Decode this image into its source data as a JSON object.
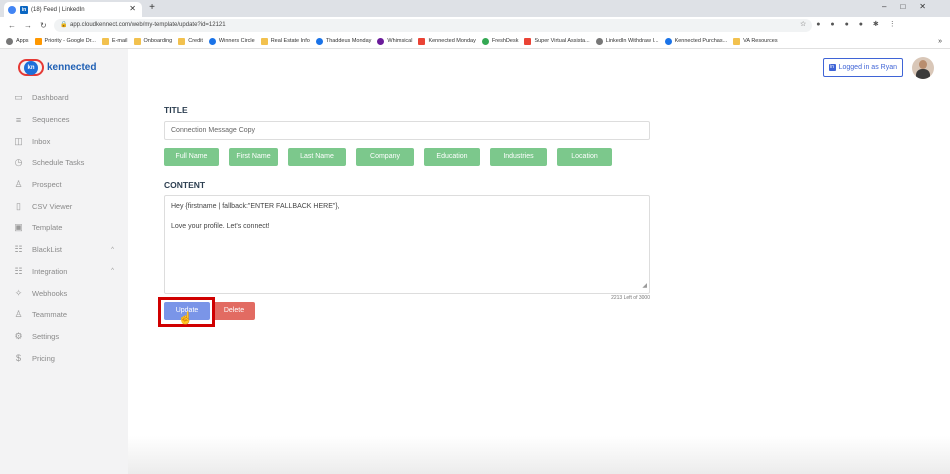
{
  "browser": {
    "tab_title": "(18) Feed | LinkedIn",
    "tab_badge": "in",
    "new_tab": "+",
    "url": "app.cloudkennect.com/web/my-template/update?id=12121",
    "bookmarks": [
      {
        "label": "Apps",
        "icon": "grey"
      },
      {
        "label": "Priority - Google Dr...",
        "icon": "orange"
      },
      {
        "label": "E-mail",
        "icon": "folder"
      },
      {
        "label": "Onboarding",
        "icon": "folder"
      },
      {
        "label": "Credit",
        "icon": "folder"
      },
      {
        "label": "Winners Circle",
        "icon": "blue"
      },
      {
        "label": "Real Estate Info",
        "icon": "folder"
      },
      {
        "label": "Thaddeus Monday",
        "icon": "blue"
      },
      {
        "label": "Whimsical",
        "icon": "purple"
      },
      {
        "label": "Kennected Monday",
        "icon": "red"
      },
      {
        "label": "FreshDesk",
        "icon": "green"
      },
      {
        "label": "Super Virtual Assista...",
        "icon": "red"
      },
      {
        "label": "LinkedIn Withdraw I...",
        "icon": "grey"
      },
      {
        "label": "Kennected Purchas...",
        "icon": "blue"
      },
      {
        "label": "VA Resources",
        "icon": "folder"
      }
    ]
  },
  "app": {
    "logo_badge": "kn",
    "logo_text": "kennected",
    "logged_in_badge": "in",
    "logged_in": "Logged in as Ryan",
    "nav": [
      {
        "label": "Dashboard",
        "icon": "monitor-icon",
        "glyph": "▭",
        "chevron": ""
      },
      {
        "label": "Sequences",
        "icon": "list-icon",
        "glyph": "≡",
        "chevron": ""
      },
      {
        "label": "Inbox",
        "icon": "chat-icon",
        "glyph": "◫",
        "chevron": ""
      },
      {
        "label": "Schedule Tasks",
        "icon": "clock-icon",
        "glyph": "◷",
        "chevron": ""
      },
      {
        "label": "Prospect",
        "icon": "user-icon",
        "glyph": "♙",
        "chevron": ""
      },
      {
        "label": "CSV Viewer",
        "icon": "file-icon",
        "glyph": "▯",
        "chevron": ""
      },
      {
        "label": "Template",
        "icon": "template-icon",
        "glyph": "▣",
        "chevron": ""
      },
      {
        "label": "BlackList",
        "icon": "blacklist-icon",
        "glyph": "☷",
        "chevron": "^"
      },
      {
        "label": "Integration",
        "icon": "integration-icon",
        "glyph": "☷",
        "chevron": "^"
      },
      {
        "label": "Webhooks",
        "icon": "webhook-icon",
        "glyph": "✧",
        "chevron": ""
      },
      {
        "label": "Teammate",
        "icon": "teammate-icon",
        "glyph": "♙",
        "chevron": ""
      },
      {
        "label": "Settings",
        "icon": "settings-icon",
        "glyph": "⚙",
        "chevron": ""
      },
      {
        "label": "Pricing",
        "icon": "dollar-icon",
        "glyph": "$",
        "chevron": ""
      }
    ]
  },
  "form": {
    "title_label": "TITLE",
    "title_value": "Connection Message Copy",
    "tags": [
      "Full Name",
      "First Name",
      "Last Name",
      "Company",
      "Education",
      "Industries",
      "Location"
    ],
    "content_label": "CONTENT",
    "content_lines": [
      "Hey {firstname | fallback:\"ENTER FALLBACK HERE\"},",
      "",
      "Love your profile. Let's connect!"
    ],
    "char_count": "2213 Left of 3000",
    "update_label": "Update",
    "delete_label": "Delete"
  },
  "colors": {
    "tag_green": "#7cc88c",
    "update_blue": "#7a95e8",
    "delete_red": "#e26b62",
    "highlight_red": "#d00000",
    "brand_blue": "#1e5fb4"
  }
}
